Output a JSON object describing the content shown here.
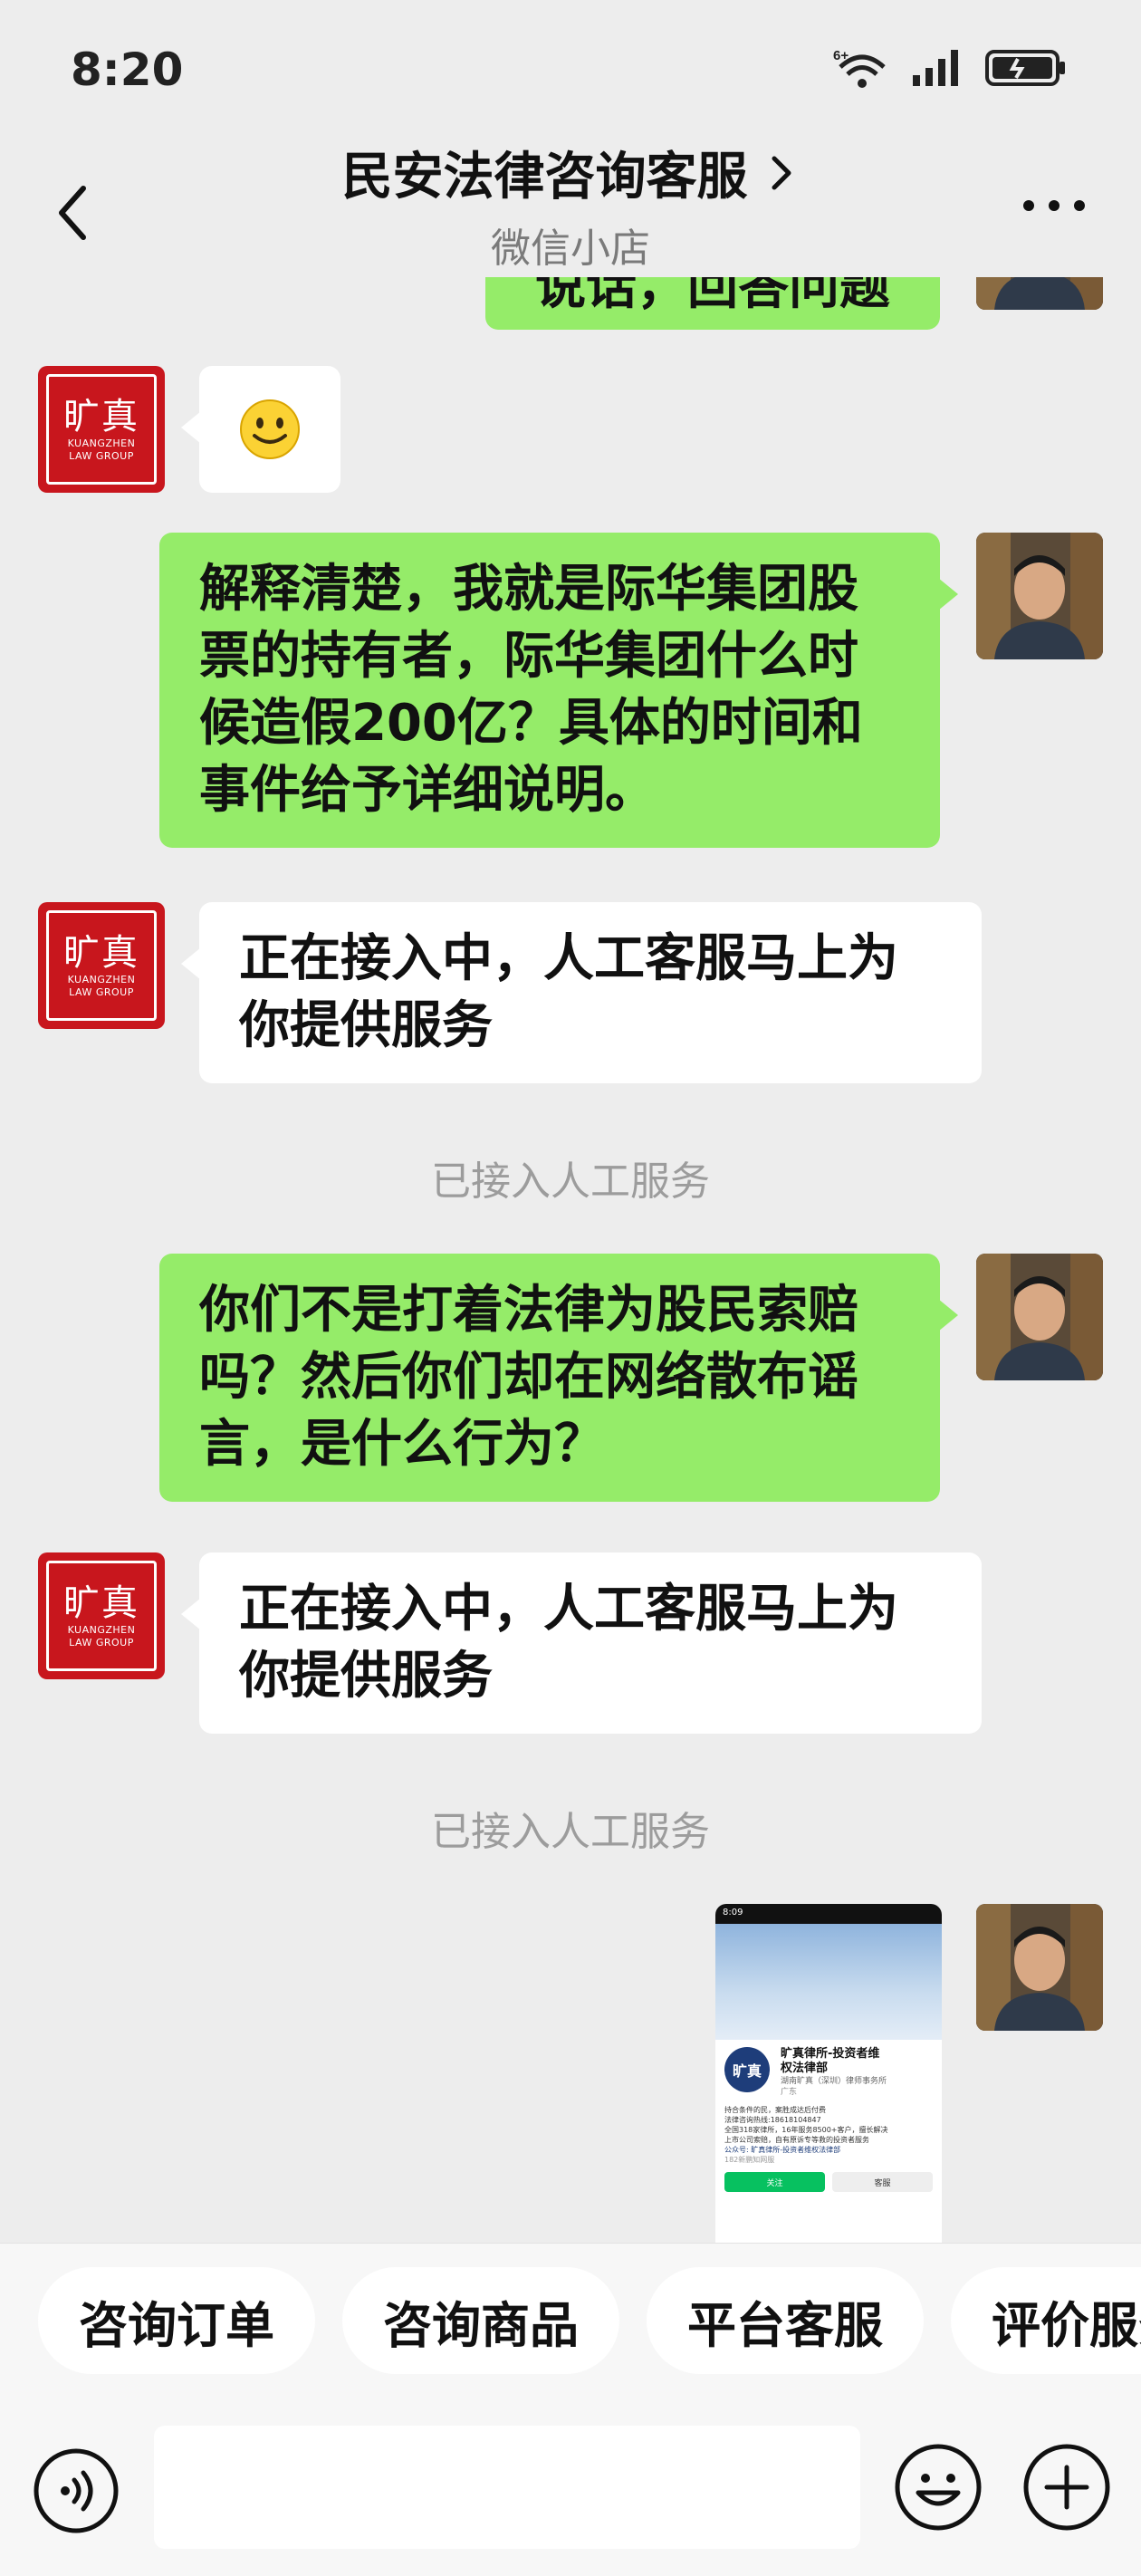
{
  "status_bar": {
    "time": "8:20",
    "network_badge": "6+",
    "icons": [
      "wifi-icon",
      "signal-icon",
      "battery-charging-icon"
    ]
  },
  "header": {
    "title": "民安法律咨询客服",
    "subtitle": "微信小店",
    "icons": [
      "back-icon",
      "chevron-right-icon",
      "more-icon"
    ]
  },
  "chat": {
    "partial_top_text": "说话，回答问题",
    "messages": [
      {
        "side": "left",
        "type": "emoji",
        "content": "🙂"
      },
      {
        "side": "right",
        "type": "text",
        "lines": [
          "解释清楚，我就是际华集团股",
          "票的持有者，际华集团什么时",
          "候造假200亿？具体的时间和",
          "事件给予详细说明。"
        ]
      },
      {
        "side": "left",
        "type": "text",
        "lines": [
          "正在接入中，人工客服马上为",
          "你提供服务"
        ]
      },
      {
        "side": "center",
        "type": "system",
        "text": "已接入人工服务"
      },
      {
        "side": "right",
        "type": "text",
        "lines": [
          "你们不是打着法律为股民索赔",
          "吗？然后你们却在网络散布谣",
          "言，是什么行为？"
        ]
      },
      {
        "side": "left",
        "type": "text",
        "lines": [
          "正在接入中，人工客服马上为",
          "你提供服务"
        ]
      },
      {
        "side": "center",
        "type": "system",
        "text": "已接入人工服务"
      },
      {
        "side": "right",
        "type": "image"
      }
    ],
    "brand_avatar": {
      "cn": "旷真",
      "en1": "KUANGZHEN",
      "en2": "LAW GROUP"
    },
    "screenshot_card": {
      "time": "8:09",
      "logo": "旷真",
      "account_name_1": "旷真律所-投资者维",
      "account_name_2": "权法律部",
      "company": "湖南旷真（深圳）律师事务所",
      "region": "广东",
      "desc_1": "持合条件的民，案胜成达后付费",
      "desc_2": "法律咨询热线:18618104847",
      "desc_3": "全国318家律所，16年服务8500+客户，擅长解决",
      "desc_4": "上市公司索赔，自有原诉专等救的投资者服务",
      "desc_5": "公众号: 旷真律所-投资者维权法律部",
      "followers": "182新鹏知网服",
      "follow_btn": "关注",
      "service_btn": "客服"
    }
  },
  "quick_replies": [
    "咨询订单",
    "咨询商品",
    "平台客服",
    "评价服务"
  ],
  "input_bar": {
    "icons": [
      "voice-icon",
      "emoji-icon",
      "plus-icon"
    ]
  },
  "colors": {
    "background": "#ededed",
    "green_bubble": "#95ec69",
    "white_bubble": "#ffffff",
    "brand_red": "#c8161d"
  }
}
